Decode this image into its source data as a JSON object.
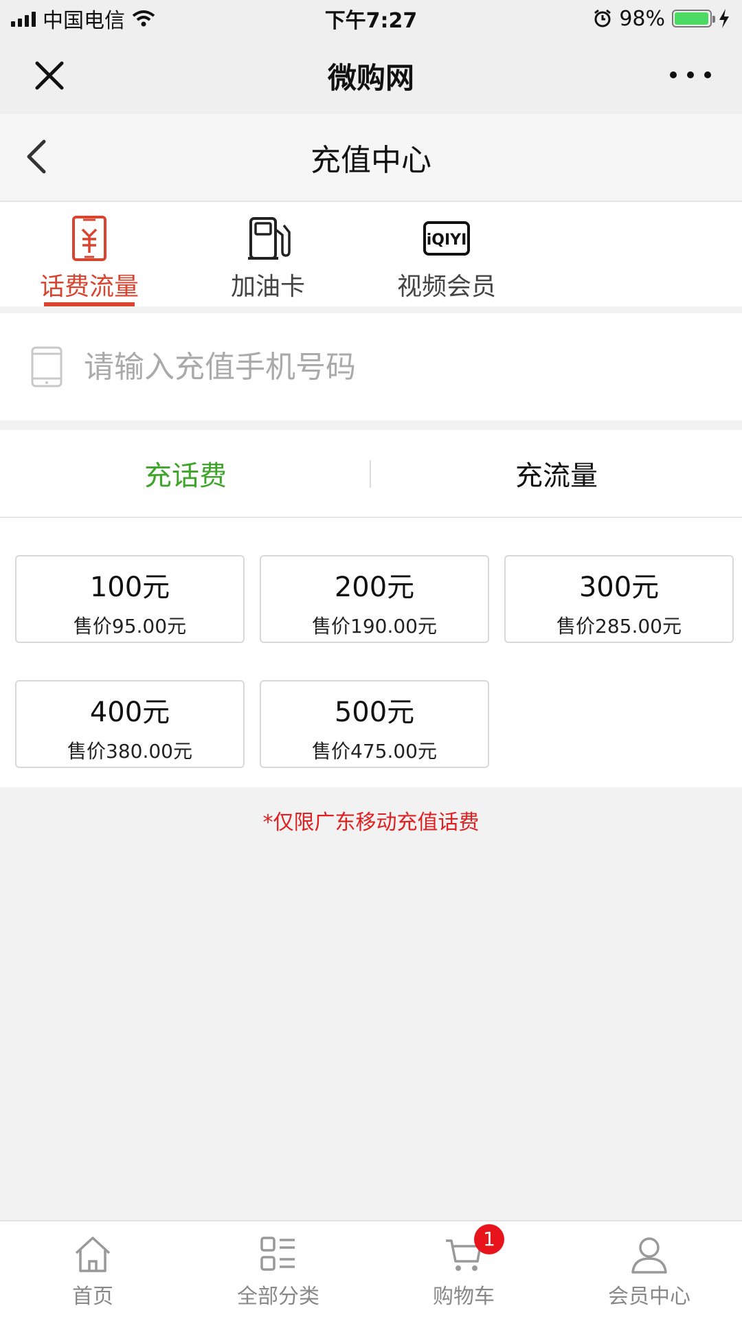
{
  "status_bar": {
    "carrier": "中国电信",
    "time": "下午7:27",
    "battery_percent": "98%",
    "battery_level": 0.98,
    "battery_color": "#4cd964"
  },
  "wechat_nav": {
    "title": "微购网"
  },
  "header": {
    "title": "充值中心"
  },
  "category_tabs": [
    {
      "label": "话费流量",
      "icon": "phone-bill-icon",
      "active": true
    },
    {
      "label": "加油卡",
      "icon": "gas-pump-icon",
      "active": false
    },
    {
      "label": "视频会员",
      "icon": "iqiyi-logo-icon",
      "active": false,
      "logo_text": "iQIYI"
    }
  ],
  "phone_input": {
    "placeholder": "请输入充值手机号码",
    "value": ""
  },
  "sub_tabs": [
    {
      "label": "充话费",
      "active": true
    },
    {
      "label": "充流量",
      "active": false
    }
  ],
  "amounts": [
    {
      "face": "100元",
      "price": "售价95.00元"
    },
    {
      "face": "200元",
      "price": "售价190.00元"
    },
    {
      "face": "300元",
      "price": "售价285.00元"
    },
    {
      "face": "400元",
      "price": "售价380.00元"
    },
    {
      "face": "500元",
      "price": "售价475.00元"
    }
  ],
  "notice": "*仅限广东移动充值话费",
  "tabbar": [
    {
      "label": "首页",
      "icon": "home-icon"
    },
    {
      "label": "全部分类",
      "icon": "category-icon"
    },
    {
      "label": "购物车",
      "icon": "cart-icon",
      "badge": "1"
    },
    {
      "label": "会员中心",
      "icon": "user-icon"
    }
  ],
  "colors": {
    "accent_red": "#d8442f",
    "accent_green": "#3fa52a",
    "notice_red": "#e02020",
    "badge_red": "#e8141c"
  }
}
